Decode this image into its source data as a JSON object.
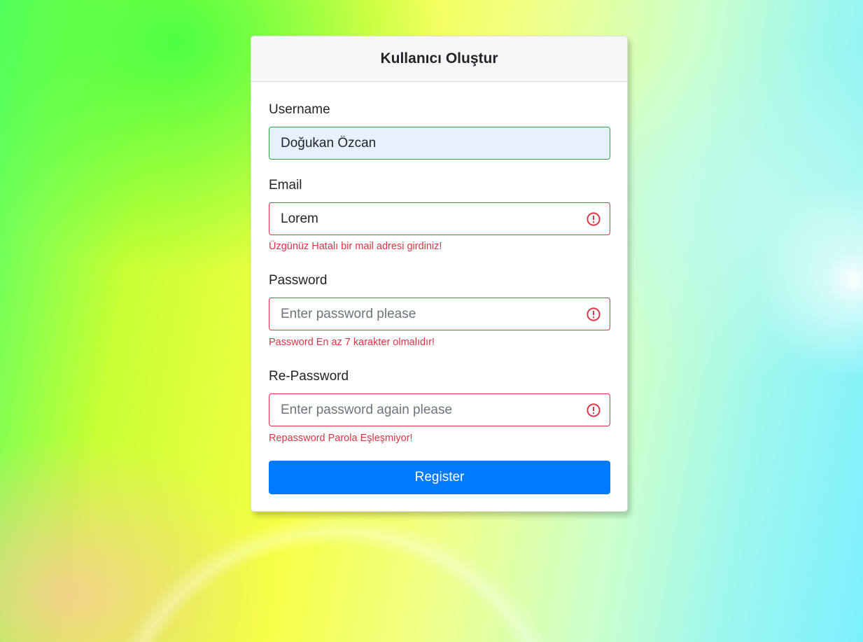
{
  "form": {
    "title": "Kullanıcı Oluştur",
    "username": {
      "label": "Username",
      "value": "Doğukan Özcan",
      "placeholder": ""
    },
    "email": {
      "label": "Email",
      "value": "Lorem",
      "placeholder": "",
      "error": "Üzgünüz Hatalı bir mail adresi girdiniz!"
    },
    "password": {
      "label": "Password",
      "value": "",
      "placeholder": "Enter password please",
      "error": "Password En az 7 karakter olmalıdır!"
    },
    "repassword": {
      "label": "Re-Password",
      "value": "",
      "placeholder": "Enter password again please",
      "error": "Repassword Parola Eşleşmiyor!"
    },
    "submit_label": "Register"
  },
  "icons": {
    "error": "exclamation-circle-icon"
  },
  "colors": {
    "primary": "#007bff",
    "error": "#dc3545",
    "valid": "#28a745",
    "autofill_bg": "#e8f0fe"
  }
}
